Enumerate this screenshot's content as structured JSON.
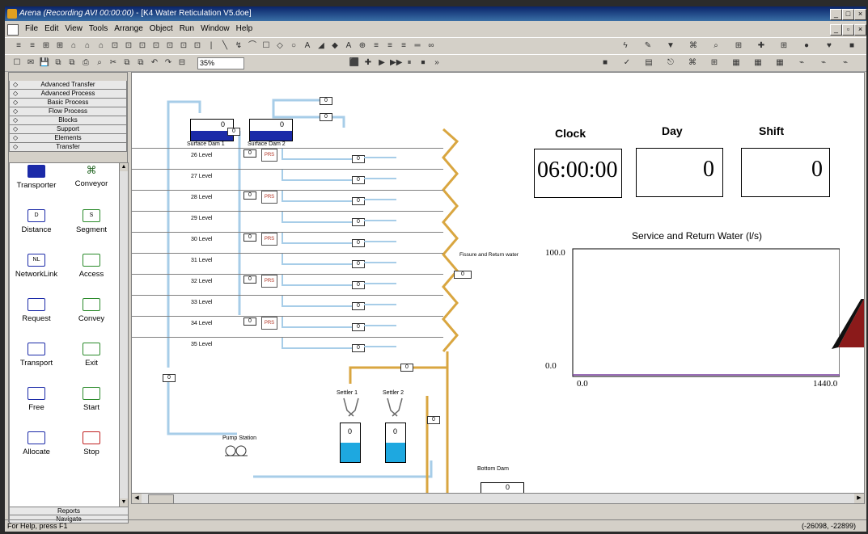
{
  "window": {
    "title_app": "Arena (Recording AVI 00:00:00)",
    "title_doc": "- [K4 Water Reticulation V5.doe]"
  },
  "menu": [
    "File",
    "Edit",
    "View",
    "Tools",
    "Arrange",
    "Object",
    "Run",
    "Window",
    "Help"
  ],
  "toolbar": {
    "zoom": "35%"
  },
  "panel": {
    "templates": [
      "Advanced Transfer",
      "Advanced Process",
      "Basic Process",
      "Flow Process",
      "Blocks",
      "Support",
      "Elements",
      "Transfer"
    ],
    "modules": [
      {
        "label": "Transporter",
        "icon": "transporter-icon"
      },
      {
        "label": "Conveyor",
        "icon": "conveyor-icon"
      },
      {
        "label": "Distance",
        "code": "D"
      },
      {
        "label": "Segment",
        "code": "S"
      },
      {
        "label": "NetworkLink",
        "code": "NL"
      },
      {
        "label": "Access"
      },
      {
        "label": "Request"
      },
      {
        "label": "Convey"
      },
      {
        "label": "Transport"
      },
      {
        "label": "Exit"
      },
      {
        "label": "Free"
      },
      {
        "label": "Start"
      },
      {
        "label": "Allocate"
      },
      {
        "label": "Stop"
      }
    ],
    "bottom_tabs": [
      "Reports",
      "Navigate"
    ]
  },
  "diagram": {
    "surface_dam_1": "Surface Dam 1",
    "surface_dam_2": "Surface Dam 2",
    "levels": [
      "26 Level",
      "27 Level",
      "28 Level",
      "29 Level",
      "30 Level",
      "31 Level",
      "32 Level",
      "33 Level",
      "34 Level",
      "35 Level"
    ],
    "prs_label": "PRS",
    "counter_zero": "0",
    "fissure_label": "Fissure and Return water",
    "settler_1": "Settler 1",
    "settler_2": "Settler 2",
    "pump_station": "Pump Station",
    "bottom_dam": "Bottom Dam"
  },
  "dashboard": {
    "clock_label": "Clock",
    "day_label": "Day",
    "shift_label": "Shift",
    "clock_value": "06:00:00",
    "day_value": "0",
    "shift_value": "0"
  },
  "chart_data": {
    "type": "line",
    "title": "Service and Return Water (l/s)",
    "xlim": [
      0,
      1440
    ],
    "ylim": [
      0,
      100
    ],
    "x_tick_labels": [
      "0.0",
      "1440.0"
    ],
    "y_tick_labels": [
      "100.0",
      "0.0"
    ],
    "series": [
      {
        "values_x": [
          0,
          1440
        ],
        "values_y": [
          0,
          0
        ],
        "color": "#7a3fa0"
      }
    ]
  },
  "status": {
    "help": "For Help, press F1",
    "coords": "(-26098, -22899)"
  }
}
